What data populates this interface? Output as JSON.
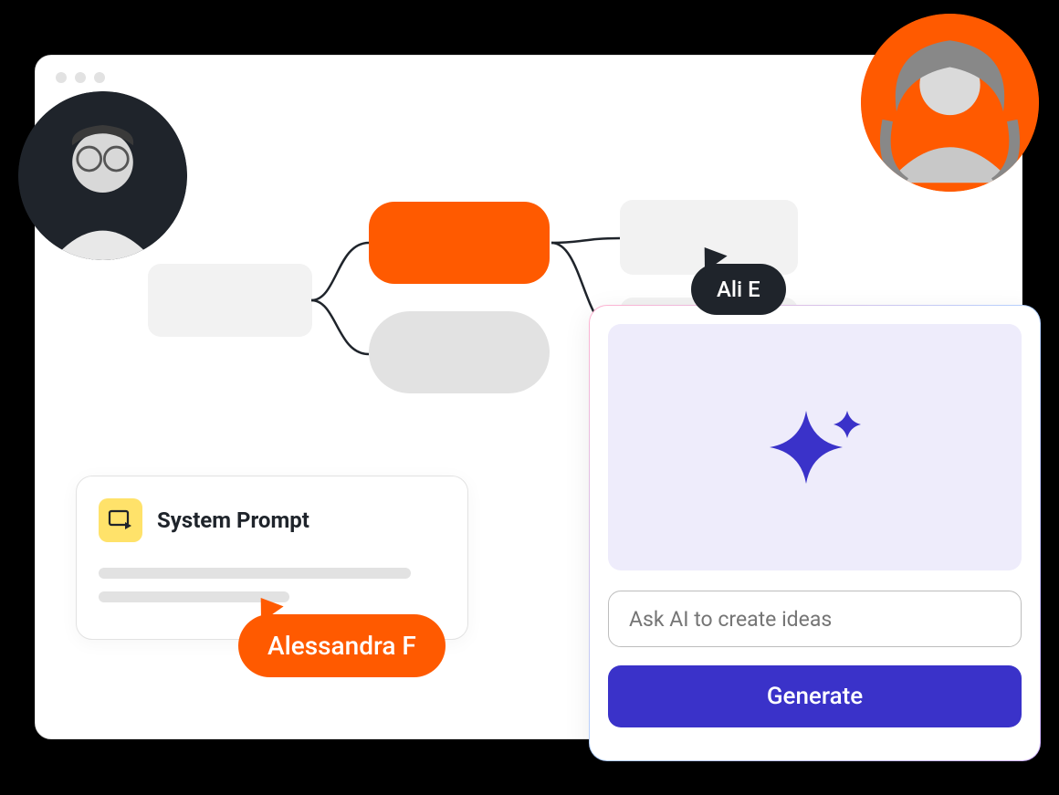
{
  "cursors": {
    "dark": {
      "label": "Ali E"
    },
    "orange": {
      "label": "Alessandra F"
    }
  },
  "system_prompt": {
    "title": "System Prompt",
    "icon_name": "display-play-icon"
  },
  "ai_panel": {
    "input_placeholder": "Ask AI to create ideas",
    "button_label": "Generate",
    "icon_name": "sparkle-icon"
  },
  "colors": {
    "accent_orange": "#ff5a00",
    "accent_indigo": "#3a32c9",
    "accent_yellow": "#ffe26a",
    "accent_teal": "#18c6a8",
    "dark": "#1f242b"
  }
}
